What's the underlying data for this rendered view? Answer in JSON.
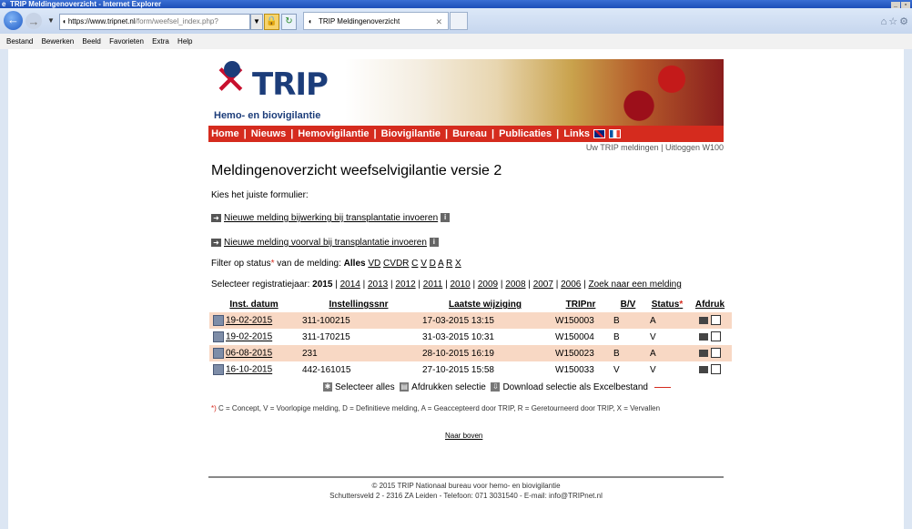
{
  "window": {
    "title": "TRIP Meldingenoverzicht - Internet Explorer",
    "url_prefix": "https://www.",
    "url_site": "tripnet.nl",
    "url_path": "/form/weefsel_index.php?",
    "tab_title": "TRIP Meldingenoverzicht"
  },
  "menubar": [
    "Bestand",
    "Bewerken",
    "Beeld",
    "Favorieten",
    "Extra",
    "Help"
  ],
  "logo": {
    "brand": "TRIP",
    "subtitle": "Hemo- en biovigilantie"
  },
  "nav": {
    "items": [
      "Home",
      "Nieuws",
      "Hemovigilantie",
      "Biovigilantie",
      "Bureau",
      "Publicaties",
      "Links"
    ]
  },
  "user": {
    "meldingen": "Uw TRIP meldingen",
    "logout": "Uitloggen W100"
  },
  "page": {
    "title": "Meldingenoverzicht weefselvigilantie versie 2",
    "choose": "Kies het juiste formulier:",
    "link1": "Nieuwe melding bijwerking bij transplantatie invoeren",
    "link2": "Nieuwe melding voorval bij transplantatie invoeren",
    "filter_label_a": "Filter op status",
    "filter_label_b": " van de melding: ",
    "filter_all": "Alles",
    "filter_options": [
      "VD",
      "CVDR",
      "C",
      "V",
      "D",
      "A",
      "R",
      "X"
    ],
    "year_label": "Selecteer registratiejaar: ",
    "year_current": "2015",
    "years": [
      "2014",
      "2013",
      "2012",
      "2011",
      "2010",
      "2009",
      "2008",
      "2007",
      "2006"
    ],
    "search_link": "Zoek naar een melding"
  },
  "table": {
    "headers": [
      "Inst. datum",
      "Instellingssnr",
      "Laatste wijziging",
      "TRIPnr",
      "B/V",
      "Status",
      "Afdruk"
    ],
    "rows": [
      [
        "19-02-2015",
        "311-100215",
        "17-03-2015 13:15",
        "W150003",
        "B",
        "A"
      ],
      [
        "19-02-2015",
        "311-170215",
        "31-03-2015 10:31",
        "W150004",
        "B",
        "V"
      ],
      [
        "06-08-2015",
        "231",
        "28-10-2015 16:19",
        "W150023",
        "B",
        "A"
      ],
      [
        "16-10-2015",
        "442-161015",
        "27-10-2015 15:58",
        "W150033",
        "V",
        "V"
      ]
    ]
  },
  "actions": {
    "select_all": "Selecteer alles",
    "print_selection": "Afdrukken selectie",
    "download": "Download selectie als Excelbestand"
  },
  "legend": "C = Concept, V = Voorlopige melding, D = Definitieve melding, A = Geaccepteerd door TRIP, R = Geretourneerd door TRIP, X = Vervallen",
  "legend_prefix": "*)",
  "back_to_top": "Naar boven",
  "footer": {
    "line1": "© 2015 TRIP Nationaal bureau voor hemo- en biovigilantie",
    "line2": "Schuttersveld 2 - 2316 ZA Leiden - Telefoon: 071 3031540 - E-mail: ",
    "email": "info@TRIPnet.nl"
  },
  "colors": {
    "brand_red": "#d52b1e",
    "brand_blue": "#1c3d7a",
    "row_highlight": "#f8d8c4"
  }
}
